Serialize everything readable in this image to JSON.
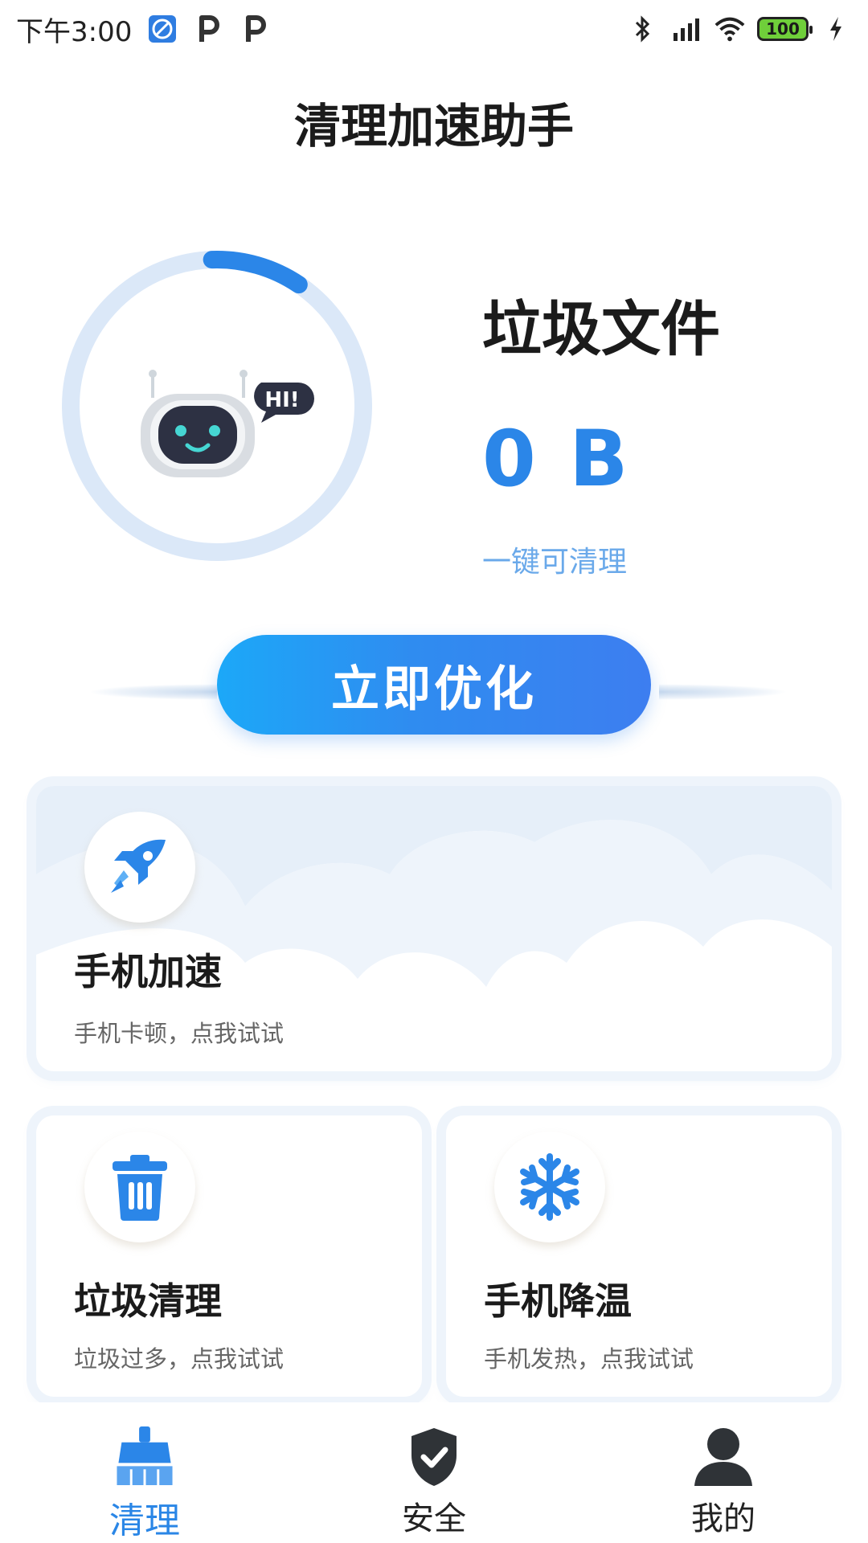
{
  "status_bar": {
    "time": "下午3:00",
    "battery": "100",
    "left_icons": [
      "browser-icon",
      "parking-app-icon",
      "parking-app-icon"
    ],
    "right_icons": [
      "bluetooth-icon",
      "signal-icon",
      "wifi-icon",
      "battery-icon",
      "charging-icon"
    ]
  },
  "header": {
    "title": "清理加速助手"
  },
  "junk": {
    "title": "垃圾文件",
    "size": "0 B",
    "subtitle": "一键可清理",
    "progress_fraction": 0.1,
    "robot_bubble": "HI!"
  },
  "optimize_button": {
    "label": "立即优化"
  },
  "cards": {
    "speed": {
      "title": "手机加速",
      "subtitle": "手机卡顿，点我试试",
      "icon": "rocket-icon"
    },
    "junk_clean": {
      "title": "垃圾清理",
      "subtitle": "垃圾过多，点我试试",
      "icon": "trash-icon"
    },
    "cool_down": {
      "title": "手机降温",
      "subtitle": "手机发热，点我试试",
      "icon": "snowflake-icon"
    }
  },
  "bottom_nav": {
    "items": [
      {
        "label": "清理",
        "icon": "broom-icon",
        "active": true
      },
      {
        "label": "安全",
        "icon": "shield-check-icon",
        "active": false
      },
      {
        "label": "我的",
        "icon": "user-icon",
        "active": false
      }
    ]
  },
  "colors": {
    "accent": "#2b86e8",
    "accent_light": "#6aa9ea",
    "ring_track": "#dbe8f8",
    "button_start": "#1ca8f8",
    "button_end": "#3d7ef0"
  }
}
